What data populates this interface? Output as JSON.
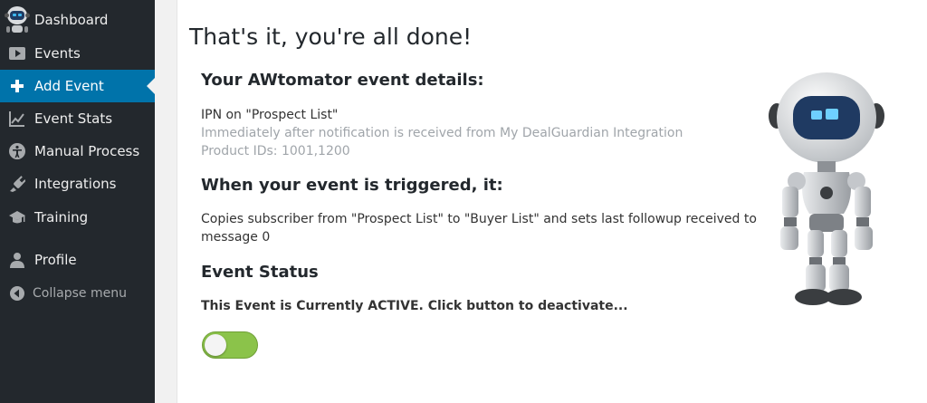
{
  "sidebar": {
    "items": [
      {
        "label": "Dashboard",
        "icon": "robot-avatar-icon"
      },
      {
        "label": "Events",
        "icon": "play-icon"
      },
      {
        "label": "Add Event",
        "icon": "plus-icon"
      },
      {
        "label": "Event Stats",
        "icon": "chart-icon"
      },
      {
        "label": "Manual Process",
        "icon": "accessibility-icon"
      },
      {
        "label": "Integrations",
        "icon": "plugin-icon"
      },
      {
        "label": "Training",
        "icon": "graduation-cap-icon"
      },
      {
        "label": "Profile",
        "icon": "user-icon"
      }
    ],
    "collapse_label": "Collapse menu",
    "active_item": "Add Event"
  },
  "main": {
    "title": "That's it, you're all done!",
    "details_heading": "Your AWtomator event details:",
    "detail_line1": "IPN on \"Prospect List\"",
    "detail_line2": "Immediately after notification is received from My DealGuardian Integration",
    "detail_line3": "Product IDs: 1001,1200",
    "trigger_heading": "When your event is triggered, it:",
    "trigger_line1": "Copies subscriber from \"Prospect List\" to \"Buyer List\" and sets last followup received to",
    "trigger_line2": "message 0",
    "status_heading": "Event Status",
    "status_text": "This Event is Currently ACTIVE. Click button to deactivate...",
    "toggle_on": true
  },
  "colors": {
    "sidebar_bg": "#23282d",
    "active_bg": "#0073aa",
    "toggle_on": "#8bc34a"
  }
}
